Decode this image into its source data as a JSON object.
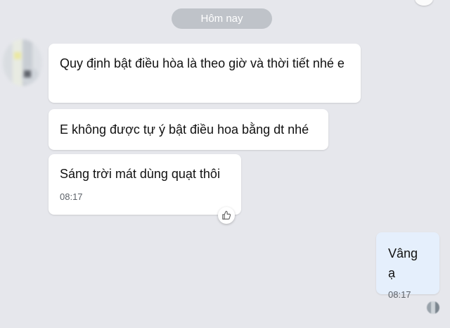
{
  "date_divider": "Hôm nay",
  "messages": [
    {
      "text": "Quy định bật điều hòa là theo giờ và thời tiết nhé e",
      "time": ""
    },
    {
      "text": "E không được tự ý bật điều hoa bằng dt nhé",
      "time": ""
    },
    {
      "text": "Sáng trời mát dùng quạt thôi",
      "time": "08:17"
    }
  ],
  "reply": {
    "text": "Vâng ạ",
    "time": "08:17"
  },
  "icons": {
    "reaction": "thumbs-up-icon"
  },
  "colors": {
    "background": "#e6e7ec",
    "incoming_bubble": "#ffffff",
    "outgoing_bubble": "#e5effc",
    "date_pill": "#bfc3c9"
  }
}
